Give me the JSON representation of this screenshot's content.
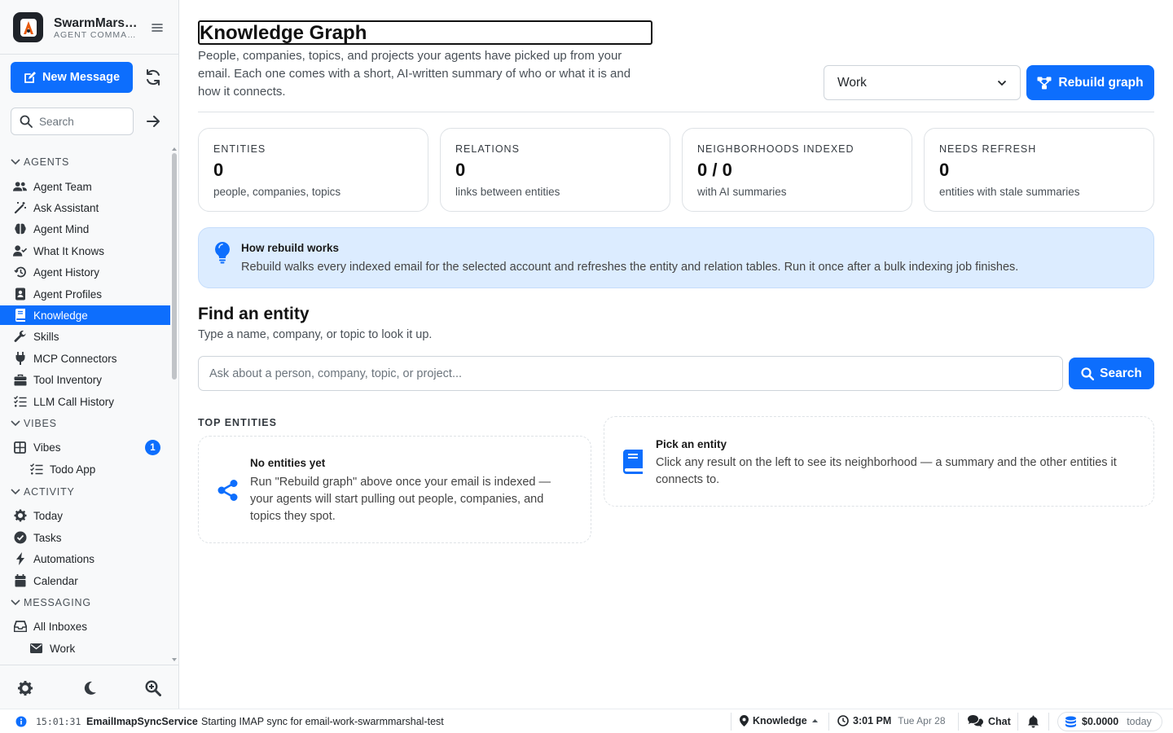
{
  "brand": {
    "name": "SwarmMarshal",
    "subtitle": "AGENT COMMAND"
  },
  "sidebar": {
    "new_message_label": "New Message",
    "search_placeholder": "Search",
    "sections": {
      "agents": "AGENTS",
      "vibes": "VIBES",
      "activity": "ACTIVITY",
      "messaging": "MESSAGING"
    },
    "agents": [
      {
        "label": "Agent Team",
        "icon": "users-icon"
      },
      {
        "label": "Ask Assistant",
        "icon": "magic-wand-icon"
      },
      {
        "label": "Agent Mind",
        "icon": "brain-icon"
      },
      {
        "label": "What It Knows",
        "icon": "user-check-icon"
      },
      {
        "label": "Agent History",
        "icon": "history-icon"
      },
      {
        "label": "Agent Profiles",
        "icon": "id-badge-icon"
      },
      {
        "label": "Knowledge",
        "icon": "book-icon",
        "active": true
      },
      {
        "label": "Skills",
        "icon": "wrench-icon"
      },
      {
        "label": "MCP Connectors",
        "icon": "plug-icon"
      },
      {
        "label": "Tool Inventory",
        "icon": "toolbox-icon"
      },
      {
        "label": "LLM Call History",
        "icon": "list-check-icon"
      }
    ],
    "vibes": [
      {
        "label": "Vibes",
        "icon": "grid-icon",
        "badge": "1"
      },
      {
        "label": "Todo App",
        "icon": "list-check-icon"
      }
    ],
    "activity": [
      {
        "label": "Today",
        "icon": "gear-icon"
      },
      {
        "label": "Tasks",
        "icon": "check-circle-icon"
      },
      {
        "label": "Automations",
        "icon": "bolt-icon"
      },
      {
        "label": "Calendar",
        "icon": "calendar-icon"
      }
    ],
    "messaging": [
      {
        "label": "All Inboxes",
        "icon": "inbox-icon"
      },
      {
        "label": "Work",
        "icon": "envelope-icon"
      }
    ]
  },
  "header": {
    "title": "Knowledge Graph",
    "description": "People, companies, topics, and projects your agents have picked up from your email. Each one comes with a short, AI-written summary of who or what it is and how it connects.",
    "account_selected": "Work",
    "rebuild_label": "Rebuild graph"
  },
  "stats": [
    {
      "label": "ENTITIES",
      "value": "0",
      "sub": "people, companies, topics"
    },
    {
      "label": "RELATIONS",
      "value": "0",
      "sub": "links between entities"
    },
    {
      "label": "NEIGHBORHOODS INDEXED",
      "value": "0 / 0",
      "sub": "with AI summaries"
    },
    {
      "label": "NEEDS REFRESH",
      "value": "0",
      "sub": "entities with stale summaries"
    }
  ],
  "info": {
    "title": "How rebuild works",
    "text": "Rebuild walks every indexed email for the selected account and refreshes the entity and relation tables. Run it once after a bulk indexing job finishes."
  },
  "find": {
    "title": "Find an entity",
    "subtitle": "Type a name, company, or topic to look it up.",
    "placeholder": "Ask about a person, company, topic, or project...",
    "search_label": "Search"
  },
  "top_entities": {
    "heading": "TOP ENTITIES",
    "empty_title": "No entities yet",
    "empty_text": "Run \"Rebuild graph\" above once your email is indexed — your agents will start pulling out people, companies, and topics they spot."
  },
  "pick": {
    "title": "Pick an entity",
    "text": "Click any result on the left to see its neighborhood — a summary and the other entities it connects to."
  },
  "statusbar": {
    "time": "15:01:31",
    "service": "EmailImapSyncService",
    "message": "Starting IMAP sync for email-work-swarmmarshal-test",
    "location": "Knowledge",
    "clock": "3:01 PM",
    "date": "Tue Apr 28",
    "chat": "Chat",
    "cost": "$0.0000",
    "cost_period": "today"
  },
  "colors": {
    "accent": "#0d6efd",
    "info_bg": "#dcecff"
  }
}
